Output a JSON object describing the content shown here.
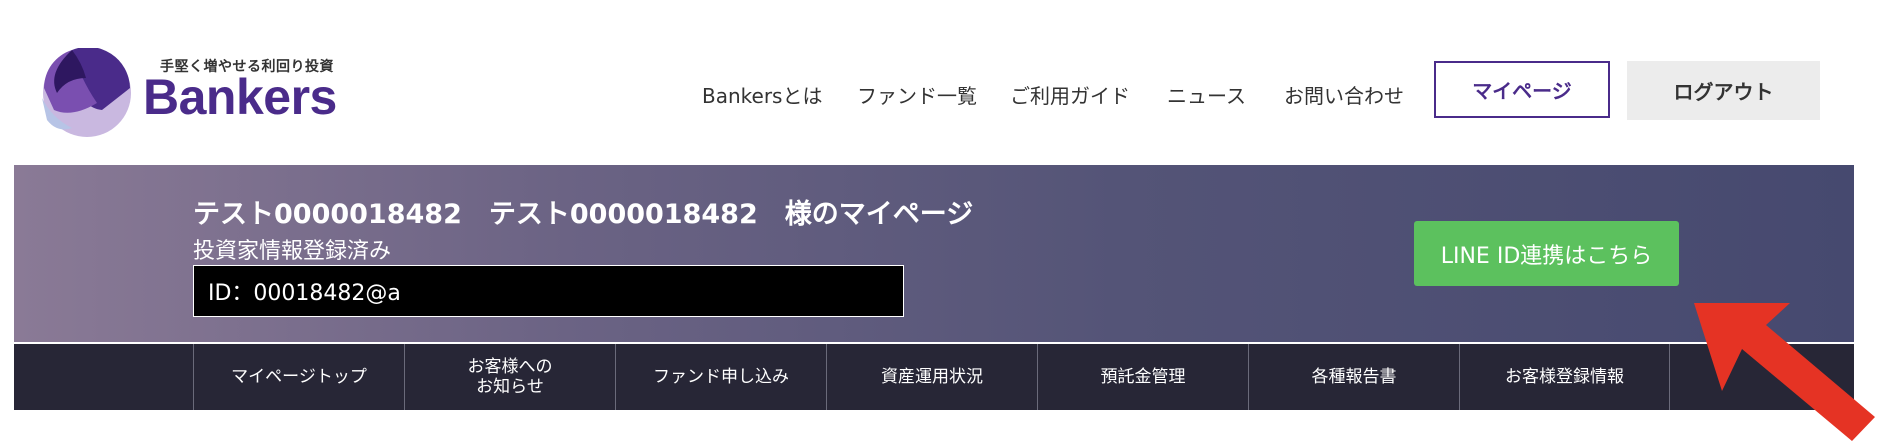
{
  "header": {
    "logo": {
      "tagline": "手堅く増やせる利回り投資",
      "name": "Bankers"
    },
    "nav": [
      {
        "label": "Bankersとは"
      },
      {
        "label": "ファンド一覧"
      },
      {
        "label": "ご利用ガイド"
      },
      {
        "label": "ニュース"
      },
      {
        "label": "お問い合わせ"
      }
    ],
    "mypage_label": "マイページ",
    "logout_label": "ログアウト"
  },
  "banner": {
    "title": "テスト0000018482　テスト0000018482　様のマイページ",
    "status": "投資家情報登録済み",
    "id_text": "ID：00018482@a",
    "line_button": "LINE ID連携はこちら"
  },
  "tabs": [
    {
      "label": "マイページトップ"
    },
    {
      "label": "お客様への\nお知らせ"
    },
    {
      "label": "ファンド申し込み"
    },
    {
      "label": "資産運用状況"
    },
    {
      "label": "預託金管理"
    },
    {
      "label": "各種報告書"
    },
    {
      "label": "お客様登録情報"
    }
  ],
  "colors": {
    "brand": "#4a2b8a",
    "line_green": "#5cc15e",
    "tab_bar": "#272636",
    "arrow": "#e53324"
  },
  "icons": {
    "logo_mark": "bankers-logo-icon",
    "pointer": "red-arrow-icon"
  }
}
